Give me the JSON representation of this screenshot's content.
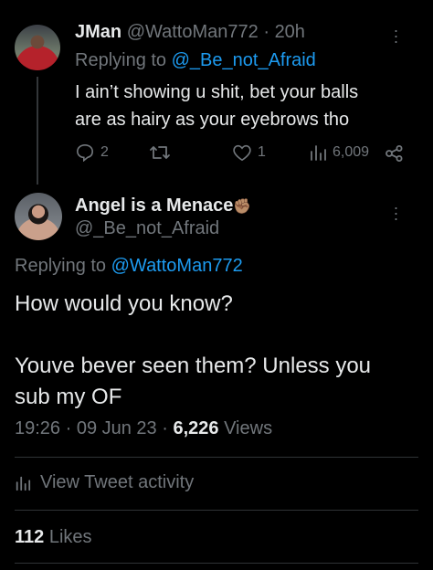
{
  "reply_tweet": {
    "author_name": "JMan",
    "handle": "@WattoMan772",
    "time": "20h",
    "replying_prefix": "Replying to",
    "replying_to": "@_Be_not_Afraid",
    "text_line1": "I ain’t showing u shit, bet your balls",
    "text_line2": "are as hairy as your eyebrows tho",
    "replies": "2",
    "likes": "1",
    "views": "6,009"
  },
  "main_tweet": {
    "author_name": "Angel is a Menace",
    "emoji": "✊🏽",
    "handle": "@_Be_not_Afraid",
    "replying_prefix": "Replying to",
    "replying_to": "@WattoMan772",
    "text_line1": "How would you know?",
    "text_line3": "Youve bever seen them? Unless you",
    "text_line4": "sub my OF",
    "timestamp": "19:26 · 09 Jun 23 ·",
    "views_count": "6,226",
    "views_label": "Views",
    "activity_label": "View Tweet activity",
    "likes_count": "112",
    "likes_label": "Likes"
  },
  "colors": {
    "background": "#000000",
    "text": "#e7e9ea",
    "muted": "#71767b",
    "link": "#1d9bf0",
    "divider": "#2f3336"
  }
}
